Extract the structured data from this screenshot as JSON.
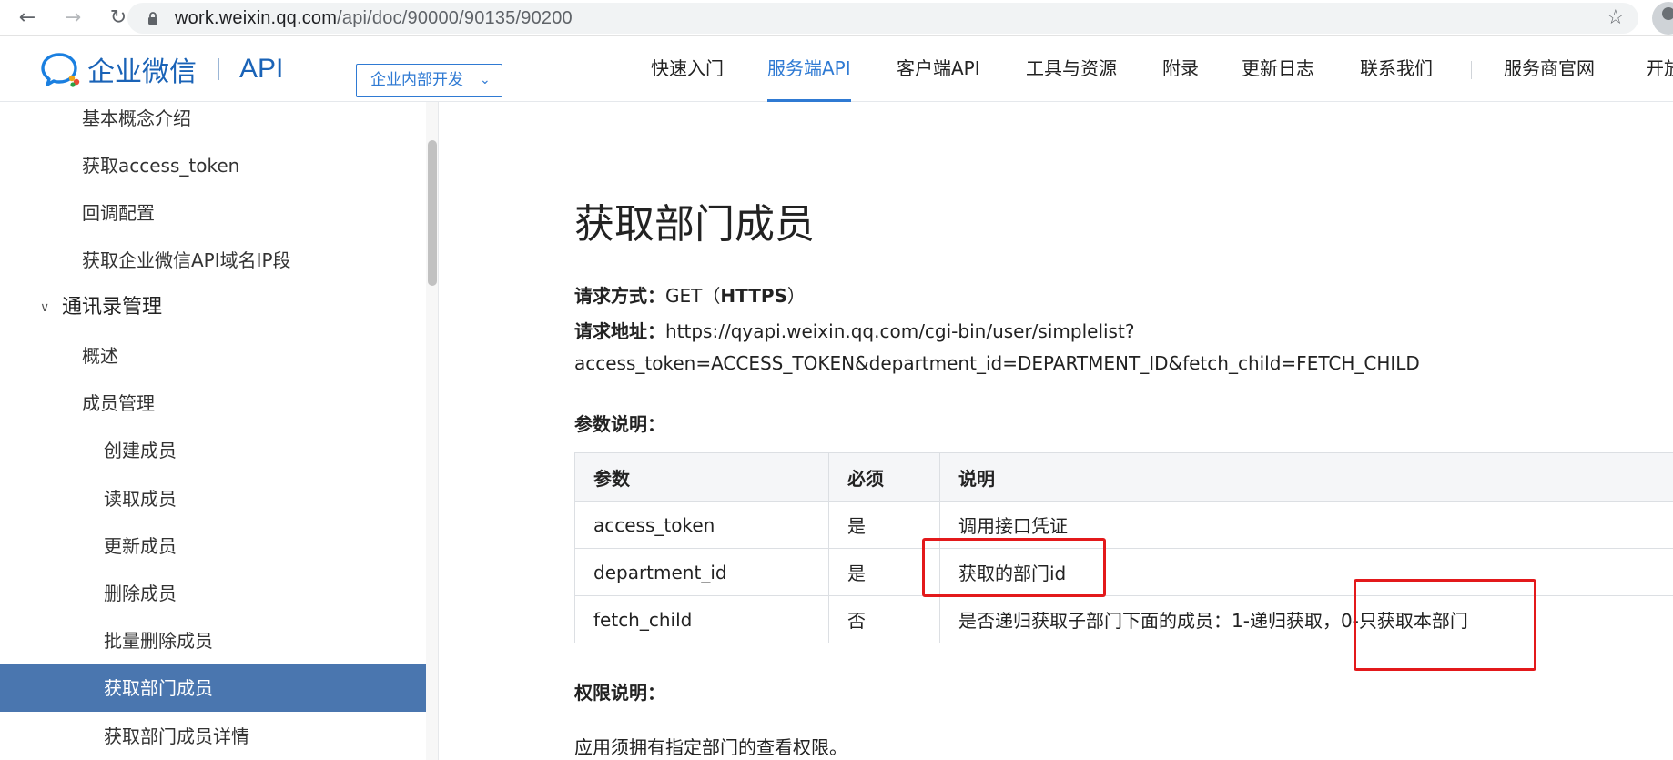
{
  "browser": {
    "url_host": "work.weixin.qq.com",
    "url_path": "/api/doc/90000/90135/90200"
  },
  "header": {
    "brand": "企业微信",
    "api": "API",
    "scope_select": "企业内部开发",
    "nav": [
      "快速入门",
      "服务端API",
      "客户端API",
      "工具与资源",
      "附录",
      "更新日志",
      "联系我们",
      "服务商官网",
      "开放"
    ],
    "active_nav": "服务端API",
    "brand_color": "#1a63b7",
    "accent_color": "#2f7ad3"
  },
  "sidebar": {
    "items": [
      {
        "label": "基本概念介绍",
        "level": 1
      },
      {
        "label": "获取access_token",
        "level": 1
      },
      {
        "label": "回调配置",
        "level": 1
      },
      {
        "label": "获取企业微信API域名IP段",
        "level": 1
      },
      {
        "label": "通讯录管理",
        "level": 0,
        "expanded": true
      },
      {
        "label": "概述",
        "level": 1
      },
      {
        "label": "成员管理",
        "level": 1
      },
      {
        "label": "创建成员",
        "level": 2
      },
      {
        "label": "读取成员",
        "level": 2
      },
      {
        "label": "更新成员",
        "level": 2
      },
      {
        "label": "删除成员",
        "level": 2
      },
      {
        "label": "批量删除成员",
        "level": 2
      },
      {
        "label": "获取部门成员",
        "level": 2,
        "active": true
      },
      {
        "label": "获取部门成员详情",
        "level": 2
      }
    ],
    "active_color": "#4a76af"
  },
  "doc": {
    "title": "获取部门成员",
    "method_label": "请求方式：",
    "method_value": "GET（",
    "method_proto": "HTTPS",
    "method_close": "）",
    "address_label": "请求地址：",
    "address_line1": "https://qyapi.weixin.qq.com/cgi-bin/user/simplelist?",
    "address_line2": "access_token=ACCESS_TOKEN&department_id=DEPARTMENT_ID&fetch_child=FETCH_CHILD",
    "params_heading": "参数说明：",
    "table": {
      "headers": [
        "参数",
        "必须",
        "说明"
      ],
      "rows": [
        [
          "access_token",
          "是",
          "调用接口凭证"
        ],
        [
          "department_id",
          "是",
          "获取的部门id"
        ],
        [
          "fetch_child",
          "否",
          "是否递归获取子部门下面的成员：1-递归获取，0-只获取本部门"
        ]
      ]
    },
    "permission_heading": "权限说明：",
    "permission_text": "应用须拥有指定部门的查看权限。"
  },
  "annotation_color": "#e3191b"
}
